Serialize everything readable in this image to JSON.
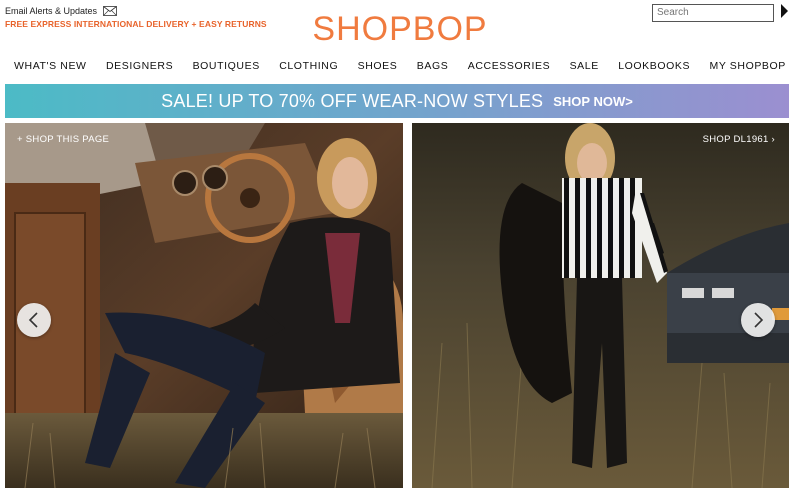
{
  "header": {
    "alerts_label": "Email Alerts & Updates",
    "promo": "FREE EXPRESS INTERNATIONAL DELIVERY + EASY RETURNS",
    "logo": "SHOPBOP",
    "search_placeholder": "Search"
  },
  "nav": {
    "items": [
      "WHAT'S NEW",
      "DESIGNERS",
      "BOUTIQUES",
      "CLOTHING",
      "SHOES",
      "BAGS",
      "ACCESSORIES",
      "SALE",
      "LOOKBOOKS",
      "MY SHOPBOP"
    ]
  },
  "banner": {
    "text": "SALE! UP TO 70% OFF WEAR-NOW STYLES",
    "cta": "SHOP NOW>"
  },
  "hero": {
    "left_label": "+ SHOP THIS PAGE",
    "right_label": "SHOP DL1961 ›"
  },
  "colors": {
    "brand": "#f07b3f",
    "promo": "#e8632b",
    "banner_start": "#4cbbc6",
    "banner_end": "#9b8fd0"
  },
  "icons": {
    "alerts": "envelope-icon",
    "search_go": "arrow-right-icon",
    "prev": "chevron-left-icon",
    "next": "chevron-right-icon"
  }
}
